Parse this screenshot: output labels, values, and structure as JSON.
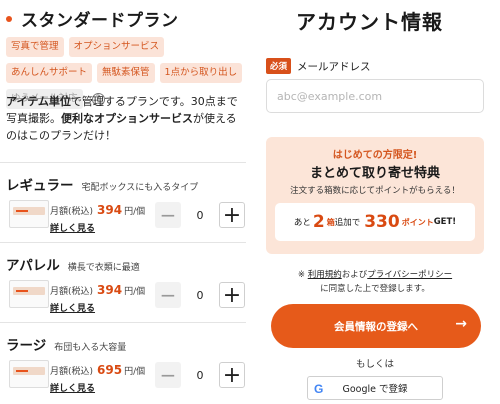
{
  "plan": {
    "title": "スタンダードプラン",
    "tags": [
      {
        "label": "写真で管理",
        "disabled": false
      },
      {
        "label": "オプションサービス",
        "disabled": false
      },
      {
        "label": "あんしんサポート",
        "disabled": false
      },
      {
        "label": "無駄素保管",
        "disabled": false
      },
      {
        "label": "1点から取り出し",
        "disabled": false
      },
      {
        "label": "ゆうメール対応",
        "disabled": true
      }
    ],
    "help_icon": "?",
    "desc_bold1": "アイテム単位",
    "desc_text1": "で管理するプランです。30点まで写真撮影。",
    "desc_bold2": "便利なオプションサービス",
    "desc_text2": "が使えるのはこのプランだけ！"
  },
  "items": [
    {
      "name": "レギュラー",
      "sub": "宅配ボックスにも入るタイプ",
      "price_label": "月額(税込)",
      "price": "394",
      "unit": "円/個",
      "more": "詳しく見る",
      "qty": "0"
    },
    {
      "name": "アパレル",
      "sub": "横長で衣類に最適",
      "price_label": "月額(税込)",
      "price": "394",
      "unit": "円/個",
      "more": "詳しく見る",
      "qty": "0"
    },
    {
      "name": "ラージ",
      "sub": "布団も入る大容量",
      "price_label": "月額(税込)",
      "price": "695",
      "unit": "円/個",
      "more": "詳しく見る",
      "qty": "0"
    }
  ],
  "qty_minus": "−",
  "qty_plus": "+",
  "account": {
    "title": "アカウント情報",
    "required": "必須",
    "email_label": "メールアドレス",
    "email_placeholder": "abc@example.com",
    "email_value": ""
  },
  "promo": {
    "tag": "はじめての方限定!",
    "title": "まとめて取り寄せ特典",
    "desc": "注文する箱数に応じてポイントがもらえる！",
    "pre": "あと",
    "boxes": "2",
    "boxes_unit": "箱",
    "mid": "追加で",
    "points": "330",
    "points_unit": "ポイント",
    "suffix": "GET!"
  },
  "terms": {
    "prefix": "※",
    "link1": "利用規約",
    "and": "および",
    "link2": "プライバシーポリシー",
    "suffix": "に同意した上で登録します。"
  },
  "register_button": "会員情報の登録へ",
  "register_arrow": "→",
  "or_text": "もしくは",
  "google": {
    "icon": "G",
    "label": "Google で登録"
  },
  "colors": {
    "accent": "#e65a1a",
    "tag_bg": "#fbe3d8",
    "promo_bg": "#fce5d8"
  }
}
